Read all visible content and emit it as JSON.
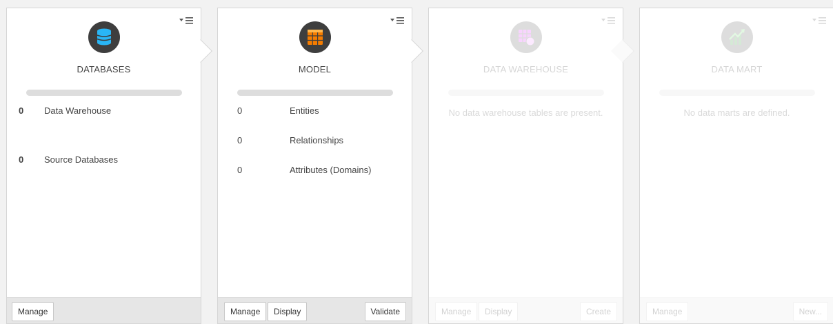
{
  "menu_icon": "dropdown-list-icon",
  "colors": {
    "databases_icon": "#29b6f6",
    "model_icon": "#f57c00",
    "warehouse_icon": "#e040fb",
    "mart_icon": "#43a047"
  },
  "databases": {
    "icon": "database-icon",
    "title": "DATABASES",
    "stats": [
      {
        "count": "0",
        "label": "Data Warehouse"
      },
      {
        "count": "0",
        "label": "Source Databases"
      }
    ],
    "manage_label": "Manage"
  },
  "model": {
    "icon": "table-grid-icon",
    "title": "MODEL",
    "stats": [
      {
        "count": "0",
        "label": "Entities"
      },
      {
        "count": "0",
        "label": "Relationships"
      },
      {
        "count": "0",
        "label": "Attributes (Domains)"
      }
    ],
    "manage_label": "Manage",
    "display_label": "Display",
    "validate_label": "Validate"
  },
  "data_warehouse": {
    "icon": "warehouse-table-icon",
    "title": "DATA WAREHOUSE",
    "empty_message": "No data warehouse tables are present.",
    "manage_label": "Manage",
    "display_label": "Display",
    "create_label": "Create"
  },
  "data_mart": {
    "icon": "chart-growth-icon",
    "title": "DATA MART",
    "empty_message": "No data marts are defined.",
    "manage_label": "Manage",
    "new_label": "New..."
  }
}
